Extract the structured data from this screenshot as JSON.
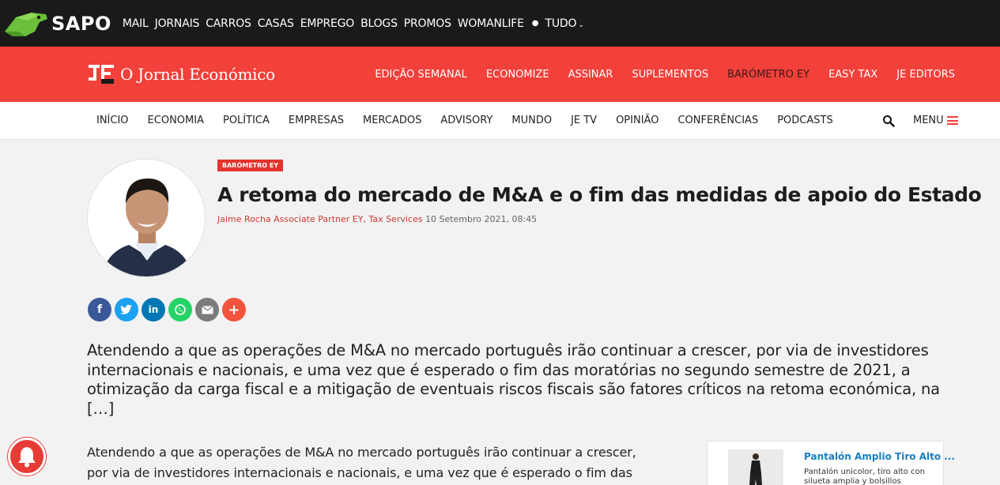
{
  "sapo": {
    "brand": "SAPO",
    "nav": [
      "MAIL",
      "JORNAIS",
      "CARROS",
      "CASAS",
      "EMPREGO",
      "BLOGS",
      "PROMOS",
      "WOMANLIFE"
    ],
    "more_label": "TUDO"
  },
  "je": {
    "logo_mark": "JE",
    "title": "O Jornal Económico",
    "nav": [
      "EDIÇÃO SEMANAL",
      "ECONOMIZE",
      "ASSINAR",
      "SUPLEMENTOS",
      "BARÓMETRO EY",
      "EASY TAX",
      "JE EDITORS"
    ]
  },
  "sections": {
    "nav": [
      "INÍCIO",
      "ECONOMIA",
      "POLÍTICA",
      "EMPRESAS",
      "MERCADOS",
      "ADVISORY",
      "MUNDO",
      "JE TV",
      "OPINIÃO",
      "CONFERÊNCIAS",
      "PODCASTS"
    ],
    "menu_label": "MENU"
  },
  "article": {
    "category": "BARÓMETRO EY",
    "title": "A retoma do mercado de M&A e o fim das medidas de apoio do Estado",
    "author": "Jaime Rocha Associate Partner EY, Tax Services",
    "date": "10 Setembro 2021, 08:45",
    "lead": "Atendendo a que as operações de M&A no mercado português irão continuar a crescer, por via de investidores internacionais e nacionais, e uma vez que é esperado o fim das moratórias no segundo semestre de 2021, a otimização da carga fiscal e a mitigação de eventuais riscos fiscais são fatores críticos na retoma económica, na […]",
    "body": "Atendendo a que as operações de M&A no mercado português irão continuar a crescer, por via de investidores internacionais e nacionais, e uma vez que é esperado o fim das"
  },
  "share": {
    "icons": [
      "facebook-icon",
      "twitter-icon",
      "linkedin-icon",
      "whatsapp-icon",
      "email-icon",
      "plus-icon"
    ],
    "colors": [
      "#3b5998",
      "#1da1f2",
      "#0077b5",
      "#25d366",
      "#7b7b7b",
      "#f2533c"
    ]
  },
  "ad": {
    "title": "Pantalón Amplio Tiro Alto ...",
    "description": "Pantalón unicolor, tiro alto con silueta amplia y bolsillos"
  },
  "colors": {
    "sapo_bg": "#1a1a1a",
    "je_red": "#f2403a",
    "accent_link": "#d03a34",
    "ad_title": "#1a7fbf"
  }
}
